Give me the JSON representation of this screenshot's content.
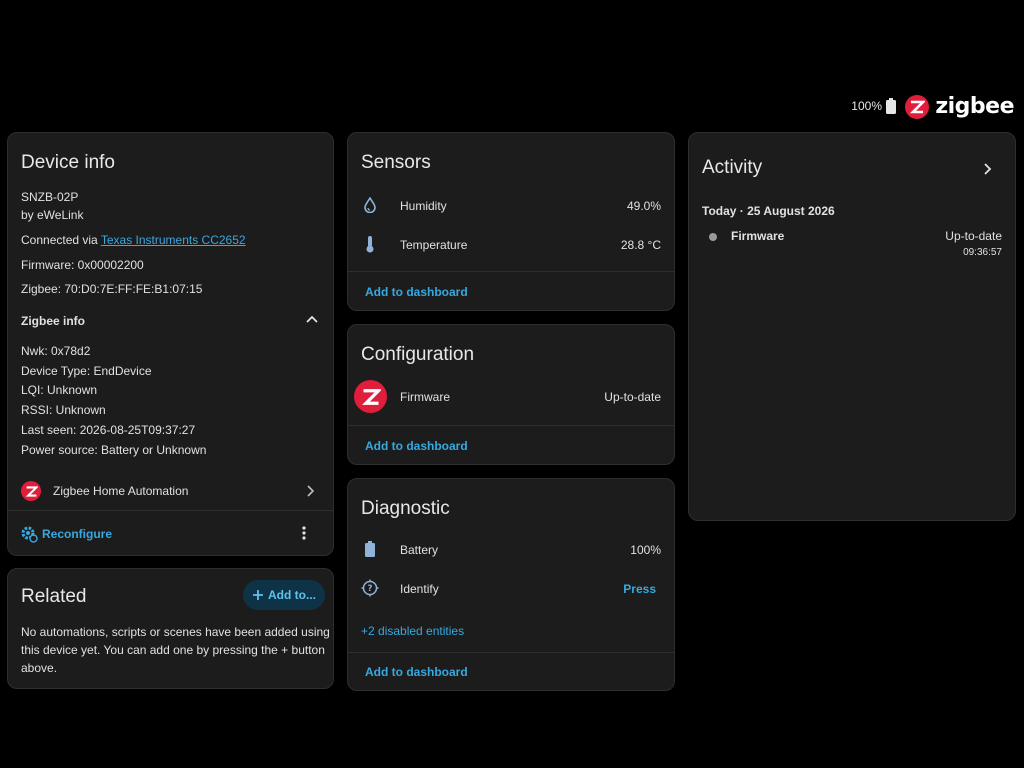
{
  "status": {
    "battery": "100%",
    "brand": "zigbee"
  },
  "device_info": {
    "title": "Device info",
    "model": "SNZB-02P",
    "manufacturer": "by eWeLink",
    "connected_prefix": "Connected via ",
    "connected_link": "Texas Instruments CC2652",
    "firmware": "Firmware: 0x00002200",
    "zigbee": "Zigbee: 70:D0:7E:FF:FE:B1:07:15",
    "zigbee_info_title": "Zigbee info",
    "nwk": "Nwk: 0x78d2",
    "device_type": "Device Type: EndDevice",
    "lqi": "LQI: Unknown",
    "rssi": "RSSI: Unknown",
    "last_seen": "Last seen: 2026-08-25T09:37:27",
    "power_source": "Power source: Battery or Unknown",
    "integration": "Zigbee Home Automation",
    "reconfigure": "Reconfigure"
  },
  "related": {
    "title": "Related",
    "add_button": "Add to...",
    "empty_text_1": "No automations, scripts or scenes have been added using",
    "empty_text_2": "this device yet. You can add one by pressing the + button",
    "empty_text_3": "above."
  },
  "sensors": {
    "title": "Sensors",
    "rows": [
      {
        "label": "Humidity",
        "value": "49.0%",
        "icon": "water-drop-icon"
      },
      {
        "label": "Temperature",
        "value": "28.8 °C",
        "icon": "thermometer-icon"
      }
    ],
    "add_to_dashboard": "Add to dashboard"
  },
  "configuration": {
    "title": "Configuration",
    "rows": [
      {
        "label": "Firmware",
        "value": "Up-to-date",
        "icon": "zigbee-logo-icon"
      }
    ],
    "add_to_dashboard": "Add to dashboard"
  },
  "diagnostic": {
    "title": "Diagnostic",
    "rows": [
      {
        "label": "Battery",
        "value": "100%",
        "icon": "battery-icon"
      },
      {
        "label": "Identify",
        "value": "Press",
        "icon": "identify-icon"
      }
    ],
    "disabled_entities": "+2 disabled entities",
    "add_to_dashboard": "Add to dashboard"
  },
  "activity": {
    "title": "Activity",
    "date": "Today · 25 August 2026",
    "entries": [
      {
        "name": "Firmware",
        "state": "Up-to-date",
        "time": "09:36:57"
      }
    ]
  },
  "colors": {
    "accent": "#36a9e1",
    "zigbee_red": "#e01e3c",
    "card": "#1c1c1c",
    "background": "#000000"
  }
}
